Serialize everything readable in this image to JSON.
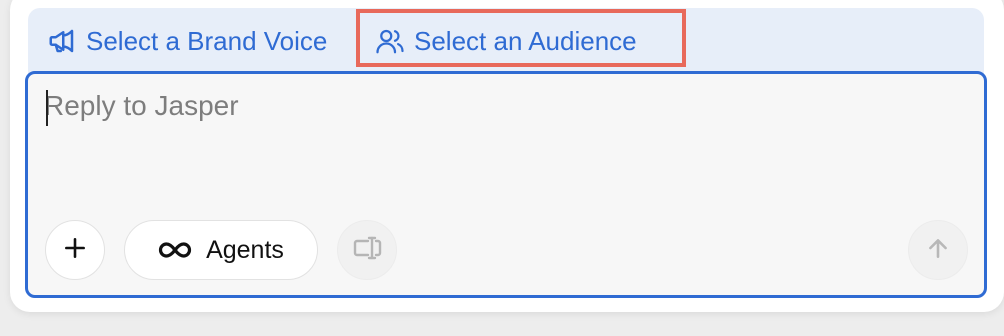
{
  "context_bar": {
    "brand_voice_label": "Select a Brand Voice",
    "audience_label": "Select an Audience"
  },
  "composer": {
    "placeholder": "Reply to Jasper",
    "value": ""
  },
  "toolbar": {
    "agents_label": "Agents"
  },
  "colors": {
    "accent": "#2f6bd3",
    "highlight": "#e8695b",
    "context_bar_bg": "#e7eef9"
  },
  "icons": {
    "brand_voice": "megaphone-icon",
    "audience": "users-icon",
    "add": "plus-icon",
    "agents": "infinity-icon",
    "text_tool": "text-cursor-box-icon",
    "send": "arrow-up-icon"
  }
}
